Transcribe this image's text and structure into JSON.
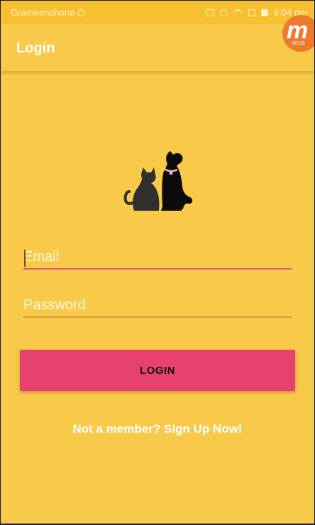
{
  "status_bar": {
    "carrier": "Grameenphone",
    "time": "9:04 pm"
  },
  "app_bar": {
    "title": "Login"
  },
  "recorder_badge": {
    "letter": "m",
    "time": "00:05"
  },
  "form": {
    "email_placeholder": "Email",
    "email_value": "",
    "password_placeholder": "Password",
    "password_value": "",
    "login_label": "LOGIN",
    "signup_text": "Not a member? Sign Up Now!"
  },
  "colors": {
    "background": "#f9c94a",
    "accent": "#e6416f",
    "text": "#ffffff"
  },
  "icons": {
    "logo": "dog-and-cat-icon"
  }
}
